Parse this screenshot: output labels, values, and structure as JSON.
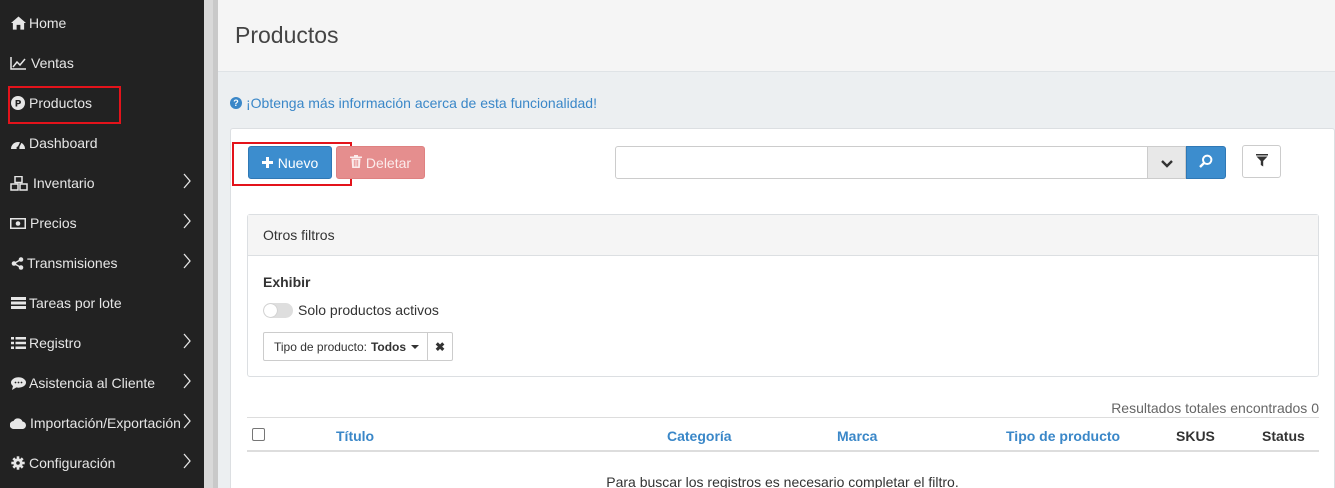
{
  "sidebar": {
    "items": [
      {
        "label": "Home",
        "icon": "home-icon",
        "has_submenu": false
      },
      {
        "label": "Ventas",
        "icon": "line-chart-icon",
        "has_submenu": false
      },
      {
        "label": "Productos",
        "icon": "product-p-icon",
        "has_submenu": false,
        "highlighted": true
      },
      {
        "label": "Dashboard",
        "icon": "dashboard-icon",
        "has_submenu": false
      },
      {
        "label": "Inventario",
        "icon": "cubes-icon",
        "has_submenu": true
      },
      {
        "label": "Precios",
        "icon": "money-icon",
        "has_submenu": true
      },
      {
        "label": "Transmisiones",
        "icon": "share-icon",
        "has_submenu": true
      },
      {
        "label": "Tareas por lote",
        "icon": "tasks-icon",
        "has_submenu": false
      },
      {
        "label": "Registro",
        "icon": "list-icon",
        "has_submenu": true
      },
      {
        "label": "Asistencia al Cliente",
        "icon": "comments-icon",
        "has_submenu": true
      },
      {
        "label": "Importación/Exportación",
        "icon": "cloud-icon",
        "has_submenu": true
      },
      {
        "label": "Configuración",
        "icon": "cog-icon",
        "has_submenu": true
      }
    ]
  },
  "header": {
    "title": "Productos"
  },
  "info_link": "¡Obtenga más información acerca de esta funcionalidad!",
  "toolbar": {
    "nuevo_label": "Nuevo",
    "deletar_label": "Deletar",
    "search_value": "",
    "search_placeholder": ""
  },
  "filters": {
    "title": "Otros filtros",
    "exhibir_label": "Exhibir",
    "toggle_label": "Solo productos activos",
    "toggle_on": false,
    "tipo_label": "Tipo de producto:",
    "tipo_value": "Todos",
    "tipo_clear": "✖"
  },
  "results": {
    "text": "Resultados totales encontrados 0"
  },
  "table": {
    "columns": [
      "Título",
      "Categoría",
      "Marca",
      "Tipo de producto",
      "SKUS",
      "Status"
    ],
    "empty_message": "Para buscar los registros es necesario completar el filtro."
  },
  "colors": {
    "sidebar_bg": "#222222",
    "primary": "#3c8dce",
    "danger_disabled": "#e58e8e",
    "link": "#3a87c8",
    "highlight": "#e3131b"
  }
}
